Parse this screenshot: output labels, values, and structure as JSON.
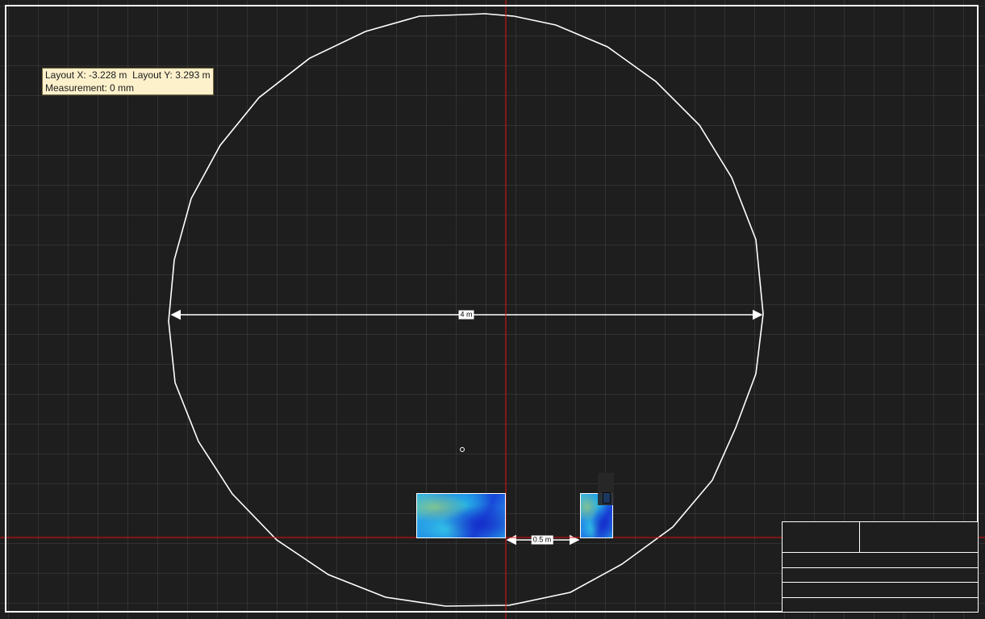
{
  "readout": {
    "layout_x": "Layout X: -3.228 m",
    "layout_y": "Layout Y: 3.293 m",
    "measurement": "Measurement: 0 mm"
  },
  "dimensions": {
    "diameter_label": "4 m",
    "spacing_label": "0.5 m"
  },
  "title_block": {
    "row_a": "",
    "row_b": "",
    "row_c": ""
  },
  "colors": {
    "background": "#1e1e1e",
    "grid": "#3a3a3a",
    "outline": "#ffffff",
    "crosshair": "#e01010",
    "readout_bg": "#fdf1cc"
  },
  "icons": {
    "origin_marker": "small-circle",
    "gizmo": "move-handle"
  }
}
